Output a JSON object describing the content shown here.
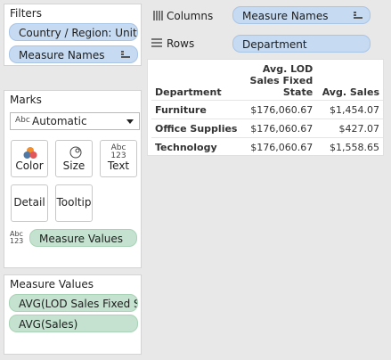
{
  "filters": {
    "title": "Filters",
    "items": [
      "Country / Region: Unit..",
      "Measure Names"
    ]
  },
  "columns_shelf": {
    "label": "Columns",
    "pill": "Measure Names"
  },
  "rows_shelf": {
    "label": "Rows",
    "pill": "Department"
  },
  "marks": {
    "title": "Marks",
    "mark_type_icon": "Abc",
    "mark_type": "Automatic",
    "buttons": {
      "color": "Color",
      "size": "Size",
      "text": "Text",
      "text_icon_top": "Abc",
      "text_icon_bottom": "123",
      "detail": "Detail",
      "tooltip": "Tooltip"
    },
    "value_icon_top": "Abc",
    "value_icon_bottom": "123",
    "value_pill": "Measure Values"
  },
  "measure_values": {
    "title": "Measure Values",
    "items": [
      "AVG(LOD Sales Fixed S..",
      "AVG(Sales)"
    ]
  },
  "table": {
    "headers": [
      "Department",
      "Avg. LOD Sales Fixed State",
      "Avg. Sales"
    ],
    "header_lines": [
      "Avg. LOD",
      "Sales Fixed",
      "State"
    ],
    "rows": [
      [
        "Furniture",
        "$176,060.67",
        "$1,454.07"
      ],
      [
        "Office Supplies",
        "$176,060.67",
        "$427.07"
      ],
      [
        "Technology",
        "$176,060.67",
        "$1,558.65"
      ]
    ]
  },
  "colors": {
    "pill_blue": "#c6daf1",
    "pill_green": "#c4e2cf"
  }
}
